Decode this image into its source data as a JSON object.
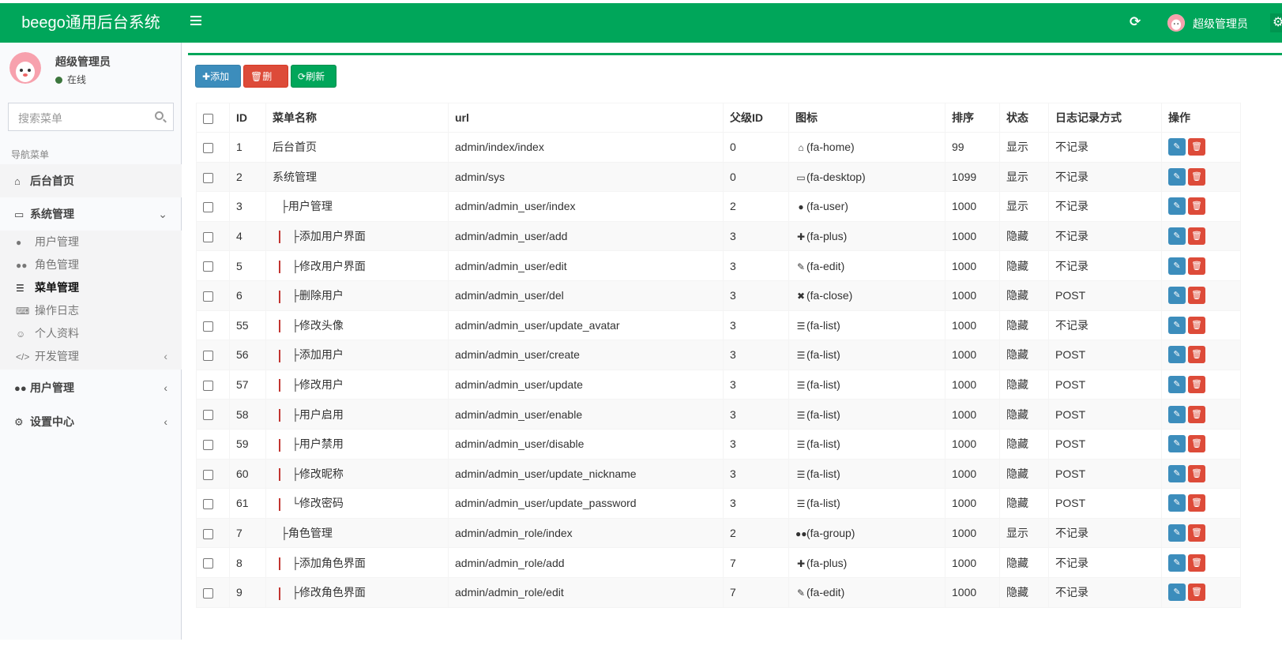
{
  "header": {
    "logo": "beego通用后台系统",
    "username": "超级管理员"
  },
  "sidebar": {
    "username": "超级管理员",
    "status": "在线",
    "search_placeholder": "搜索菜单",
    "nav_header": "导航菜单",
    "home": "后台首页",
    "system": "系统管理",
    "sub_items": [
      "用户管理",
      "角色管理",
      "菜单管理",
      "操作日志",
      "个人资料",
      "开发管理"
    ],
    "users": "用户管理",
    "settings": "设置中心"
  },
  "toolbar": {
    "add": "添加",
    "delete": "删除",
    "refresh": "刷新"
  },
  "table": {
    "columns": [
      "ID",
      "菜单名称",
      "url",
      "父级ID",
      "图标",
      "排序",
      "状态",
      "日志记录方式",
      "操作"
    ],
    "rows": [
      {
        "id": "1",
        "prefix": "",
        "name": "后台首页",
        "url": "admin/index/index",
        "pid": "0",
        "icon_glyph": "home-icon",
        "icon": "(fa-home)",
        "sort": "99",
        "status": "显示",
        "log": "不记录"
      },
      {
        "id": "2",
        "prefix": "",
        "name": "系统管理",
        "url": "admin/sys",
        "pid": "0",
        "icon_glyph": "desktop-icon",
        "icon": "(fa-desktop)",
        "sort": "1099",
        "status": "显示",
        "log": "不记录"
      },
      {
        "id": "3",
        "prefix": "├",
        "name": "用户管理",
        "url": "admin/admin_user/index",
        "pid": "2",
        "icon_glyph": "user-icon",
        "icon": "(fa-user)",
        "sort": "1000",
        "status": "显示",
        "log": "不记录"
      },
      {
        "id": "4",
        "prefix": "├",
        "name": "添加用户界面",
        "url": "admin/admin_user/add",
        "pid": "3",
        "icon_glyph": "plus-icon",
        "icon": "(fa-plus)",
        "sort": "1000",
        "status": "隐藏",
        "log": "不记录",
        "deep": true
      },
      {
        "id": "5",
        "prefix": "├",
        "name": "修改用户界面",
        "url": "admin/admin_user/edit",
        "pid": "3",
        "icon_glyph": "edit-icon",
        "icon": "(fa-edit)",
        "sort": "1000",
        "status": "隐藏",
        "log": "不记录",
        "deep": true
      },
      {
        "id": "6",
        "prefix": "├",
        "name": "删除用户",
        "url": "admin/admin_user/del",
        "pid": "3",
        "icon_glyph": "close-icon",
        "icon": "(fa-close)",
        "sort": "1000",
        "status": "隐藏",
        "log": "POST",
        "deep": true
      },
      {
        "id": "55",
        "prefix": "├",
        "name": "修改头像",
        "url": "admin/admin_user/update_avatar",
        "pid": "3",
        "icon_glyph": "list-icon",
        "icon": "(fa-list)",
        "sort": "1000",
        "status": "隐藏",
        "log": "不记录",
        "deep": true
      },
      {
        "id": "56",
        "prefix": "├",
        "name": "添加用户",
        "url": "admin/admin_user/create",
        "pid": "3",
        "icon_glyph": "list-icon",
        "icon": "(fa-list)",
        "sort": "1000",
        "status": "隐藏",
        "log": "POST",
        "deep": true
      },
      {
        "id": "57",
        "prefix": "├",
        "name": "修改用户",
        "url": "admin/admin_user/update",
        "pid": "3",
        "icon_glyph": "list-icon",
        "icon": "(fa-list)",
        "sort": "1000",
        "status": "隐藏",
        "log": "POST",
        "deep": true
      },
      {
        "id": "58",
        "prefix": "├",
        "name": "用户启用",
        "url": "admin/admin_user/enable",
        "pid": "3",
        "icon_glyph": "list-icon",
        "icon": "(fa-list)",
        "sort": "1000",
        "status": "隐藏",
        "log": "POST",
        "deep": true
      },
      {
        "id": "59",
        "prefix": "├",
        "name": "用户禁用",
        "url": "admin/admin_user/disable",
        "pid": "3",
        "icon_glyph": "list-icon",
        "icon": "(fa-list)",
        "sort": "1000",
        "status": "隐藏",
        "log": "POST",
        "deep": true
      },
      {
        "id": "60",
        "prefix": "├",
        "name": "修改昵称",
        "url": "admin/admin_user/update_nickname",
        "pid": "3",
        "icon_glyph": "list-icon",
        "icon": "(fa-list)",
        "sort": "1000",
        "status": "隐藏",
        "log": "POST",
        "deep": true
      },
      {
        "id": "61",
        "prefix": "└",
        "name": "修改密码",
        "url": "admin/admin_user/update_password",
        "pid": "3",
        "icon_glyph": "list-icon",
        "icon": "(fa-list)",
        "sort": "1000",
        "status": "隐藏",
        "log": "POST",
        "deep": true
      },
      {
        "id": "7",
        "prefix": "├",
        "name": "角色管理",
        "url": "admin/admin_role/index",
        "pid": "2",
        "icon_glyph": "group-icon",
        "icon": "(fa-group)",
        "sort": "1000",
        "status": "显示",
        "log": "不记录"
      },
      {
        "id": "8",
        "prefix": "├",
        "name": "添加角色界面",
        "url": "admin/admin_role/add",
        "pid": "7",
        "icon_glyph": "plus-icon",
        "icon": "(fa-plus)",
        "sort": "1000",
        "status": "隐藏",
        "log": "不记录",
        "deep": true
      },
      {
        "id": "9",
        "prefix": "├",
        "name": "修改角色界面",
        "url": "admin/admin_role/edit",
        "pid": "7",
        "icon_glyph": "edit-icon",
        "icon": "(fa-edit)",
        "sort": "1000",
        "status": "隐藏",
        "log": "不记录",
        "deep": true
      }
    ]
  },
  "colors": {
    "brand": "#00a65a",
    "primary": "#3c8dbc",
    "danger": "#dd4b39"
  }
}
